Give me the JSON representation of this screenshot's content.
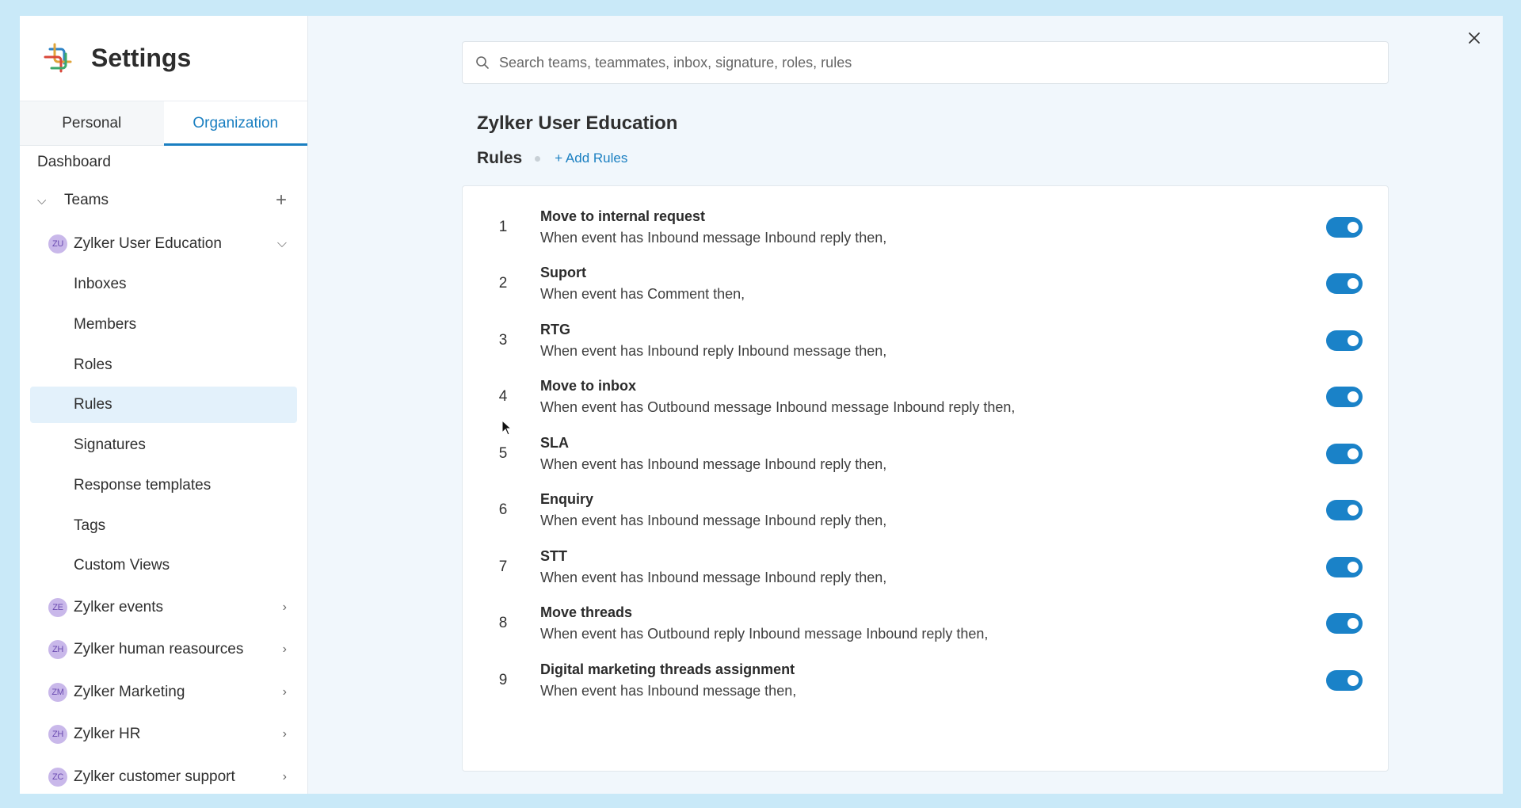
{
  "app": {
    "title": "Settings",
    "logo_icon": "settings-logo-icon"
  },
  "tabs": [
    {
      "label": "Personal",
      "active": false
    },
    {
      "label": "Organization",
      "active": true
    }
  ],
  "nav": {
    "dashboard": "Dashboard",
    "teams": "Teams",
    "current_team": {
      "initials": "ZU",
      "label": "Zylker User Education"
    },
    "sub_items": [
      "Inboxes",
      "Members",
      "Roles",
      "Rules",
      "Signatures",
      "Response templates",
      "Tags",
      "Custom Views"
    ],
    "active_sub_item": "Rules",
    "other_teams": [
      {
        "initials": "ZE",
        "label": "Zylker events"
      },
      {
        "initials": "ZH",
        "label": "Zylker human reasources"
      },
      {
        "initials": "ZM",
        "label": "Zylker Marketing"
      },
      {
        "initials": "ZH",
        "label": "Zylker HR"
      },
      {
        "initials": "ZC",
        "label": "Zylker customer support"
      }
    ]
  },
  "search": {
    "placeholder": "Search teams, teammates, inbox, signature, roles, rules"
  },
  "main": {
    "title": "Zylker User Education",
    "section": "Rules",
    "add_label": "+ Add Rules"
  },
  "rules": [
    {
      "num": "1",
      "name": "Move to internal request",
      "desc": "When event has Inbound message Inbound reply then,",
      "enabled": true
    },
    {
      "num": "2",
      "name": "Suport",
      "desc": "When event has Comment then,",
      "enabled": true
    },
    {
      "num": "3",
      "name": "RTG",
      "desc": "When event has Inbound reply Inbound message then,",
      "enabled": true
    },
    {
      "num": "4",
      "name": "Move to inbox",
      "desc": "When event has Outbound message Inbound message Inbound reply then,",
      "enabled": true
    },
    {
      "num": "5",
      "name": "SLA",
      "desc": "When event has Inbound message Inbound reply then,",
      "enabled": true
    },
    {
      "num": "6",
      "name": "Enquiry",
      "desc": "When event has Inbound message Inbound reply then,",
      "enabled": true
    },
    {
      "num": "7",
      "name": "STT",
      "desc": "When event has Inbound message Inbound reply then,",
      "enabled": true
    },
    {
      "num": "8",
      "name": "Move threads",
      "desc": "When event has Outbound reply Inbound message Inbound reply then,",
      "enabled": true
    },
    {
      "num": "9",
      "name": "Digital marketing threads assignment",
      "desc": "When event has Inbound message then,",
      "enabled": true
    }
  ],
  "colors": {
    "accent": "#1a7fc1",
    "toggle_on": "#1a82c8",
    "background": "#c9e9f8"
  }
}
